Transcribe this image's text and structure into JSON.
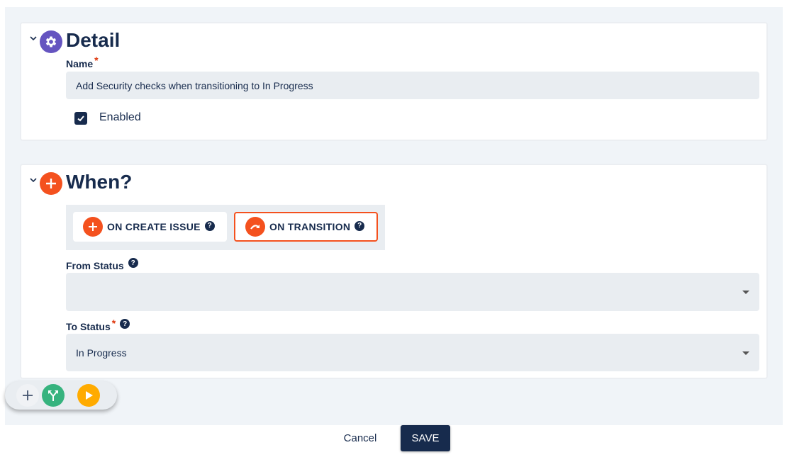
{
  "detail": {
    "title": "Detail",
    "icon": "gear-icon",
    "icon_color": "#6554c0",
    "name_label": "Name",
    "required_mark": "*",
    "name_value": "Add Security checks when transitioning to In Progress",
    "enabled_label": "Enabled",
    "enabled_checked": true
  },
  "when": {
    "title": "When?",
    "icon": "plus-circle-icon",
    "icon_color": "#f4511e",
    "triggers": [
      {
        "label": "ON CREATE ISSUE",
        "icon": "plus-icon",
        "selected": false
      },
      {
        "label": "ON TRANSITION",
        "icon": "redo-arrow-icon",
        "selected": true
      }
    ],
    "help_glyph": "?",
    "from_status_label": "From Status",
    "from_status_value": "",
    "to_status_label": "To Status",
    "to_status_required": "*",
    "to_status_value": "In Progress"
  },
  "fab": {
    "add_icon": "plus-icon",
    "branch_icon": "branch-icon",
    "branch_color": "#36b37e",
    "run_icon": "play-icon",
    "run_color": "#ffab00"
  },
  "footer": {
    "cancel_label": "Cancel",
    "save_label": "SAVE"
  },
  "colors": {
    "primary": "#172b4d",
    "accent": "#f4511e",
    "required": "#de350b"
  }
}
